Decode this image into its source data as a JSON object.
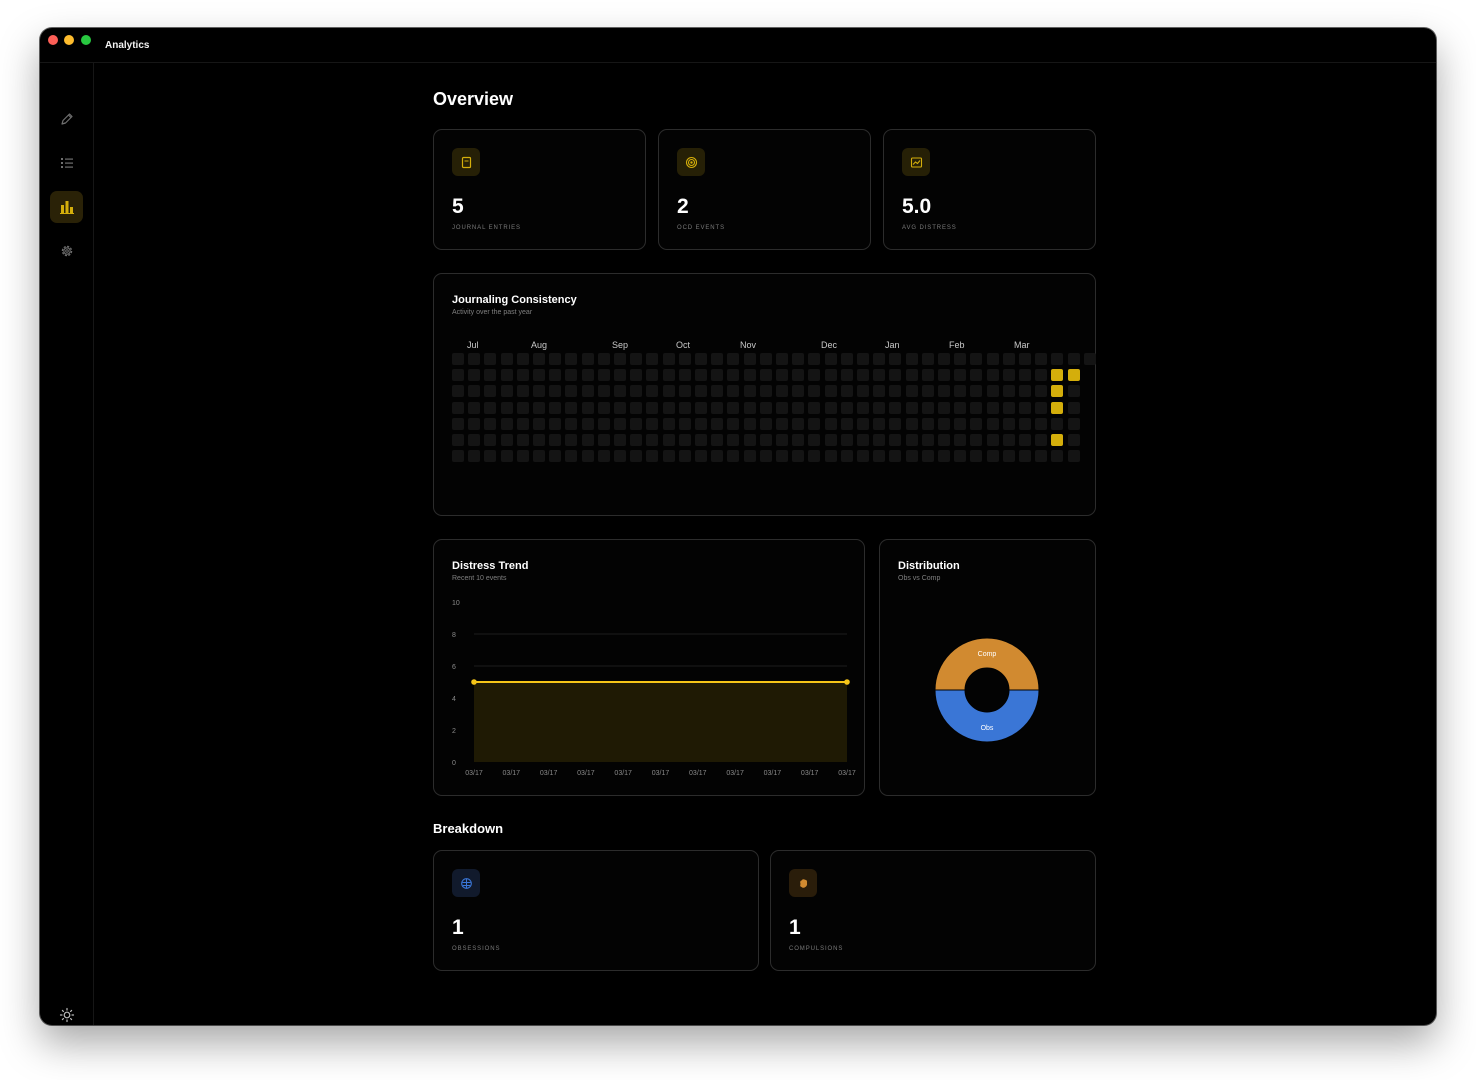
{
  "app": {
    "title": "Analytics"
  },
  "sidebar": {
    "items": [
      {
        "name": "journal",
        "icon": "pen-icon",
        "active": false
      },
      {
        "name": "entries",
        "icon": "list-icon",
        "active": false
      },
      {
        "name": "analytics",
        "icon": "bar-chart-icon",
        "active": true
      },
      {
        "name": "settings",
        "icon": "gear-icon",
        "active": false
      }
    ],
    "bottom_icon": "sun-icon"
  },
  "overview": {
    "title": "Overview",
    "stats": [
      {
        "value": "5",
        "label": "JOURNAL ENTRIES",
        "icon": "journal-icon"
      },
      {
        "value": "2",
        "label": "OCD EVENTS",
        "icon": "target-icon"
      },
      {
        "value": "5.0",
        "label": "AVG DISTRESS",
        "icon": "trend-chart-icon"
      }
    ]
  },
  "consistency": {
    "title": "Journaling Consistency",
    "subtitle": "Activity over the past year",
    "months": [
      "Jul",
      "Aug",
      "Sep",
      "Oct",
      "Nov",
      "Dec",
      "Jan",
      "Feb",
      "Mar"
    ],
    "weeks": 39,
    "active_cells": [
      [
        37,
        1
      ],
      [
        38,
        1
      ],
      [
        37,
        2
      ],
      [
        37,
        3
      ],
      [
        37,
        5
      ]
    ],
    "active_color": "#d4ae0b"
  },
  "trend": {
    "title": "Distress Trend",
    "subtitle": "Recent 10 events",
    "line_color": "#f5c518"
  },
  "distribution": {
    "title": "Distribution",
    "subtitle": "Obs vs Comp",
    "colors": {
      "Comp": "#d18a30",
      "Obs": "#3a76d6"
    }
  },
  "breakdown": {
    "title": "Breakdown",
    "items": [
      {
        "value": "1",
        "label": "OBSESSIONS",
        "icon": "brain-icon",
        "color": "#3a76d6"
      },
      {
        "value": "1",
        "label": "COMPULSIONS",
        "icon": "hand-icon",
        "color": "#d18a30"
      }
    ]
  },
  "chart_data": [
    {
      "type": "area",
      "title": "Distress Trend",
      "subtitle": "Recent 10 events",
      "x": [
        "03/17",
        "03/17",
        "03/17",
        "03/17",
        "03/17",
        "03/17",
        "03/17",
        "03/17",
        "03/17",
        "03/17",
        "03/17"
      ],
      "series": [
        {
          "values": [
            5,
            5,
            5,
            5,
            5,
            5,
            5,
            5,
            5,
            5,
            5
          ]
        }
      ],
      "ylim": [
        0,
        10
      ],
      "yticks": [
        0,
        2,
        4,
        6,
        8,
        10
      ],
      "xlabel": "",
      "ylabel": "",
      "grid": true
    },
    {
      "type": "pie",
      "title": "Distribution",
      "subtitle": "Obs vs Comp",
      "labels": [
        "Comp",
        "Obs"
      ],
      "values": [
        1,
        1
      ],
      "donut": true
    }
  ]
}
